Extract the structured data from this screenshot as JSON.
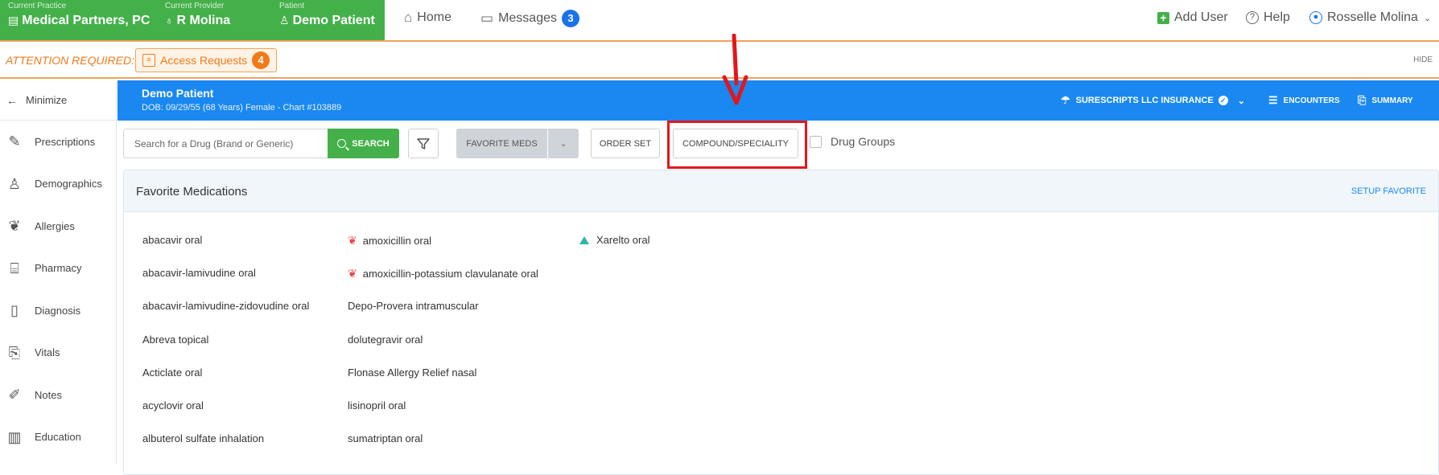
{
  "context": {
    "practice": {
      "label": "Current Practice",
      "value": "Medical Partners, PC"
    },
    "provider": {
      "label": "Current Provider",
      "value": "R Molina"
    },
    "patient": {
      "label": "Patient",
      "value": "Demo Patient"
    }
  },
  "nav": {
    "home": "Home",
    "messages": "Messages",
    "messages_count": "3"
  },
  "top_right": {
    "add_user": "Add User",
    "help": "Help",
    "user_name": "Rosselle Molina"
  },
  "attention": {
    "label": "ATTENTION REQUIRED:",
    "access_requests": "Access Requests",
    "access_count": "4",
    "hide": "HIDE"
  },
  "sidebar": {
    "minimize": "Minimize",
    "items": [
      {
        "label": "Prescriptions",
        "icon": "edit-icon"
      },
      {
        "label": "Demographics",
        "icon": "person-icon"
      },
      {
        "label": "Allergies",
        "icon": "feather-icon"
      },
      {
        "label": "Pharmacy",
        "icon": "pharmacy-icon"
      },
      {
        "label": "Diagnosis",
        "icon": "document-icon"
      },
      {
        "label": "Vitals",
        "icon": "clipboard-icon"
      },
      {
        "label": "Notes",
        "icon": "pen-icon"
      },
      {
        "label": "Education",
        "icon": "book-icon"
      }
    ]
  },
  "patient_header": {
    "name": "Demo Patient",
    "details": "DOB: 09/29/55 (68 Years) Female - Chart #103889",
    "insurance": "SURESCRIPTS LLC INSURANCE",
    "encounters": "ENCOUNTERS",
    "summary": "SUMMARY"
  },
  "toolbar": {
    "search_placeholder": "Search for a Drug (Brand or Generic)",
    "search_label": "SEARCH",
    "favorite_meds": "FAVORITE MEDS",
    "order_set": "ORDER SET",
    "compound": "COMPOUND/SPECIALITY",
    "drug_groups": "Drug Groups"
  },
  "favorites": {
    "title": "Favorite Medications",
    "setup": "SETUP FAVORITE",
    "col1": [
      "abacavir oral",
      "abacavir-lamivudine oral",
      "abacavir-lamivudine-zidovudine oral",
      "Abreva topical",
      "Acticlate oral",
      "acyclovir oral",
      "albuterol sulfate inhalation"
    ],
    "col2": [
      {
        "name": "amoxicillin oral",
        "flag": "allergy"
      },
      {
        "name": "amoxicillin-potassium clavulanate oral",
        "flag": "allergy"
      },
      {
        "name": "Depo-Provera intramuscular",
        "flag": ""
      },
      {
        "name": "dolutegravir oral",
        "flag": ""
      },
      {
        "name": "Flonase Allergy Relief nasal",
        "flag": ""
      },
      {
        "name": "lisinopril oral",
        "flag": ""
      },
      {
        "name": "sumatriptan oral",
        "flag": ""
      }
    ],
    "col3": [
      {
        "name": "Xarelto oral",
        "flag": "warning"
      }
    ]
  },
  "colors": {
    "brand_green": "#44b04a",
    "header_blue": "#1a88f0",
    "attention_orange": "#f27a1a",
    "highlight_red": "#e3161b"
  }
}
